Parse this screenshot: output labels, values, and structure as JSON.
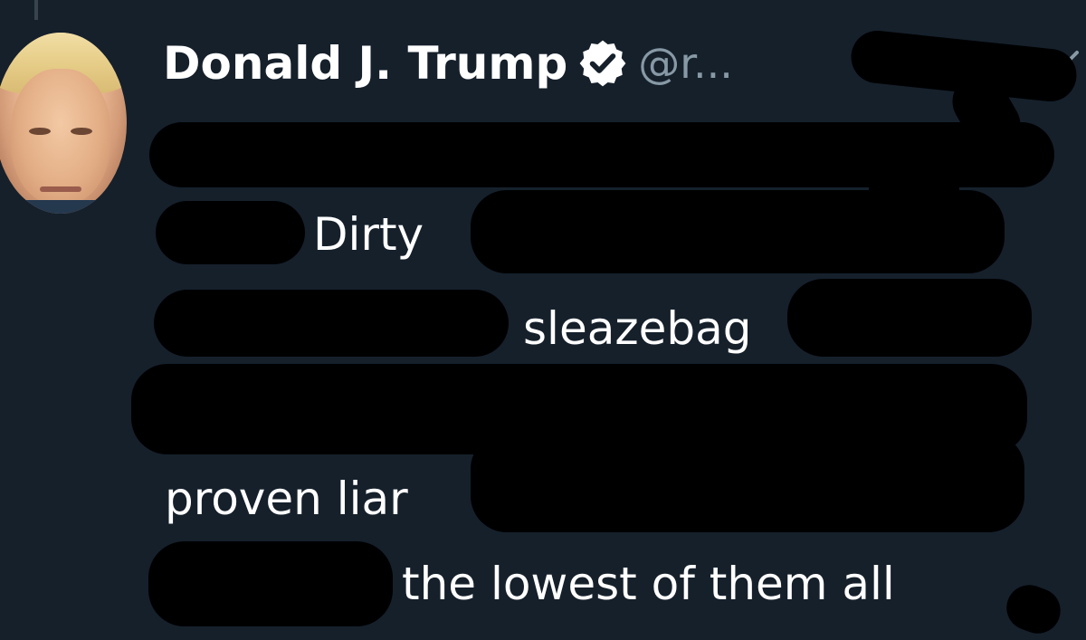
{
  "tweet": {
    "display_name": "Donald J. Trump",
    "handle": "@r...",
    "verified": true,
    "icons": {
      "verified": "verified-badge-icon",
      "more": "chevron-down-icon"
    },
    "lines": [
      "Dirty",
      "sleazebag",
      "proven liar",
      "the lowest of them all"
    ]
  },
  "colors": {
    "background": "#15202b",
    "text": "#ffffff",
    "secondary_text": "#8899a6",
    "redaction": "#000000"
  }
}
